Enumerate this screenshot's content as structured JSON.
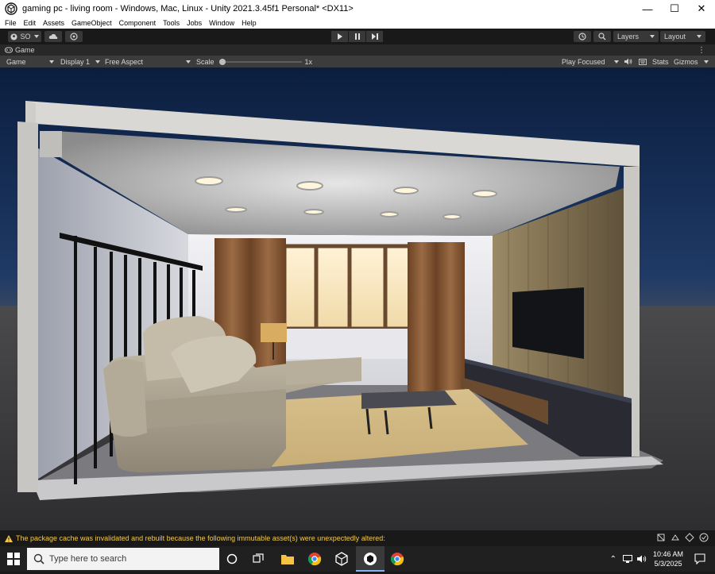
{
  "window": {
    "title": "gaming pc - living room - Windows, Mac, Linux - Unity 2021.3.45f1 Personal* <DX11>"
  },
  "menu": [
    "File",
    "Edit",
    "Assets",
    "GameObject",
    "Component",
    "Tools",
    "Jobs",
    "Window",
    "Help"
  ],
  "toolbar": {
    "account_label": "SO",
    "layers_label": "Layers",
    "layout_label": "Layout"
  },
  "game_tab": {
    "label": "Game"
  },
  "game_bar": {
    "view_mode": "Game",
    "display": "Display 1",
    "aspect": "Free Aspect",
    "scale_label": "Scale",
    "scale_value": "1x",
    "scale_fraction": 0,
    "play_mode": "Play Focused",
    "stats_label": "Stats",
    "gizmos_label": "Gizmos"
  },
  "status": {
    "message": "The package cache was invalidated and rebuilt because the following immutable asset(s) were unexpectedly altered:"
  },
  "taskbar": {
    "search_placeholder": "Type here to search",
    "time": "10:46 AM",
    "date": "5/3/2025"
  },
  "colors": {
    "unity_dark": "#191919",
    "toolbar_button": "#383838",
    "game_bar": "#3c3c3c",
    "warning": "#f2c94c",
    "taskbar": "#202020"
  }
}
